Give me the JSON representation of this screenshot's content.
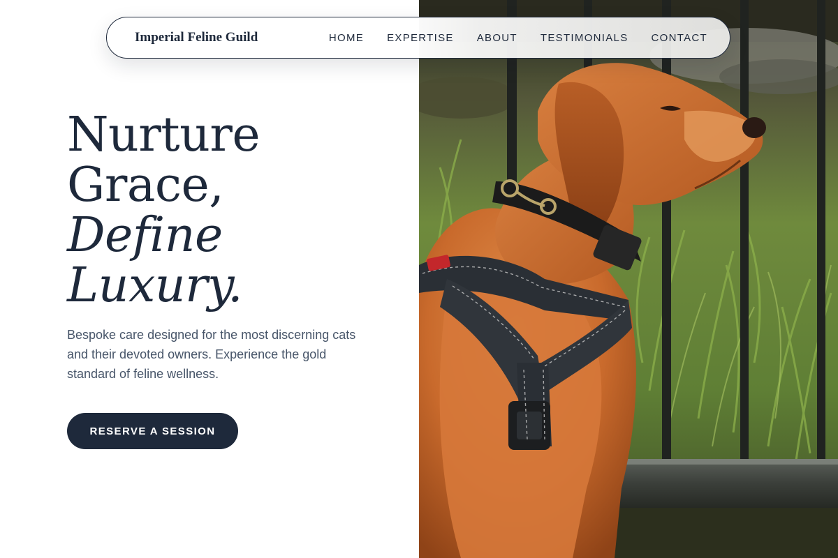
{
  "nav": {
    "brand": "Imperial Feline Guild",
    "links": [
      "HOME",
      "EXPERTISE",
      "ABOUT",
      "TESTIMONIALS",
      "CONTACT"
    ]
  },
  "hero": {
    "headline_lines": [
      "Nurture",
      "Grace,",
      "Define",
      "Luxury."
    ],
    "subtext": "Bespoke care designed for the most discerning cats and their devoted owners. Experience the gold standard of feline wellness.",
    "cta_label": "RESERVE A SESSION"
  },
  "image": {
    "subject": "dog-photo",
    "alt": "Red-coated dog wearing a black collar and harness sitting beside an iron fence"
  },
  "colors": {
    "primary": "#1e293b",
    "body_text": "#475569",
    "background": "#ffffff"
  }
}
